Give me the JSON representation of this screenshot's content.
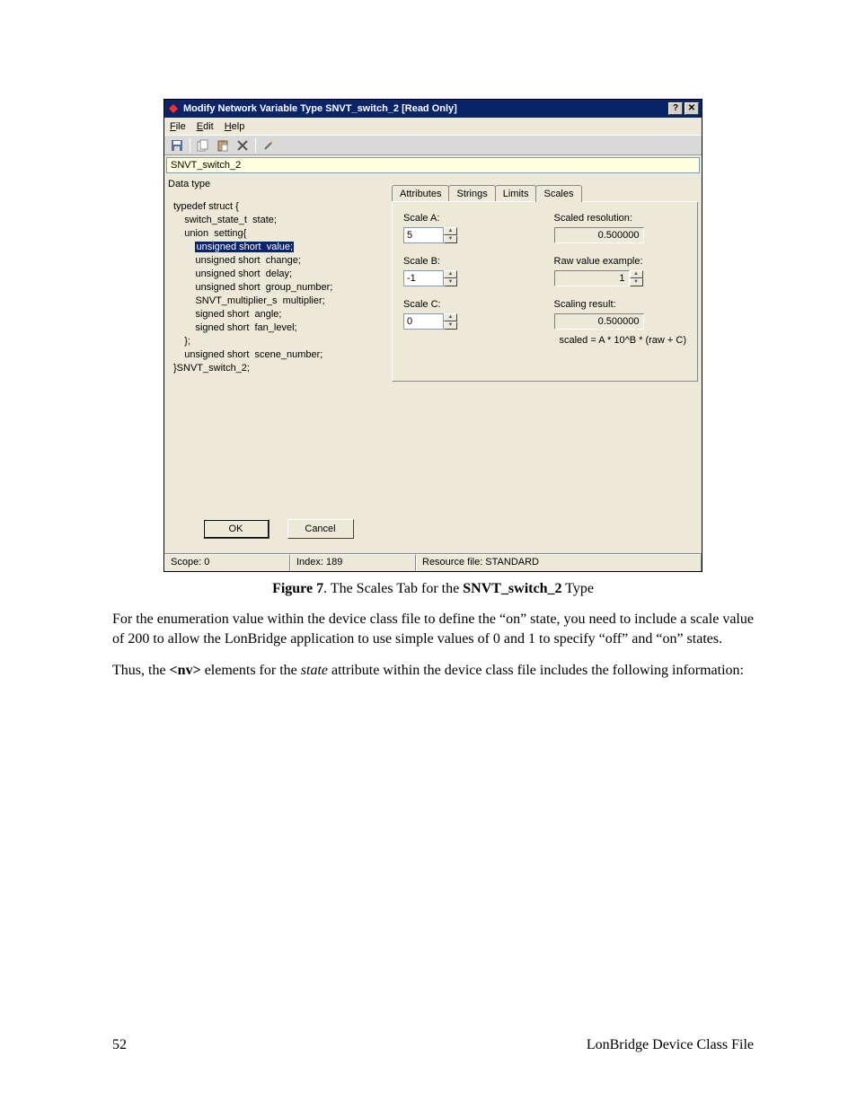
{
  "dialog": {
    "title": "Modify Network Variable Type SNVT_switch_2 [Read Only]",
    "help_btn": "?",
    "close_btn": "✕",
    "menus": {
      "file": "File",
      "file_u": "F",
      "edit": "Edit",
      "edit_u": "E",
      "help": "Help",
      "help_u": "H"
    },
    "var_name": "SNVT_switch_2",
    "data_type_label": "Data type",
    "code": {
      "l1": "typedef struct {",
      "l2": "    switch_state_t  state;",
      "l3": "    union  setting{",
      "l4_pre": "        ",
      "l4_hl": "unsigned short  value;",
      "l5": "        unsigned short  change;",
      "l6": "        unsigned short  delay;",
      "l7": "        unsigned short  group_number;",
      "l8": "        SNVT_multiplier_s  multiplier;",
      "l9": "        signed short  angle;",
      "l10": "        signed short  fan_level;",
      "l11": "    };",
      "l12": "    unsigned short  scene_number;",
      "l13": "}SNVT_switch_2;"
    },
    "ok": "OK",
    "cancel": "Cancel",
    "tabs": {
      "attr": "Attributes",
      "attr_u": "A",
      "str": "Strings",
      "lim": "Limits",
      "lim_u": "L",
      "sca": "Scales",
      "sca_u": "S"
    },
    "scales": {
      "a_label": "Scale A:",
      "a_val": "5",
      "b_label": "Scale B:",
      "b_val": "-1",
      "c_label": "Scale C:",
      "c_val": "0",
      "res_label": "Scaled resolution:",
      "res_val": "0.500000",
      "raw_label": "Raw value example:",
      "raw_val": "1",
      "out_label": "Scaling result:",
      "out_val": "0.500000",
      "formula": "scaled = A * 10^B * (raw + C)"
    },
    "status": {
      "scope": "Scope: 0",
      "index": "Index: 189",
      "res": "Resource file: STANDARD"
    }
  },
  "figure": {
    "caption_lead": "Figure 7",
    "caption_mid": ". The Scales Tab for the ",
    "caption_bold": "SNVT_switch_2",
    "caption_end": " Type"
  },
  "body": {
    "p1": "For the enumeration value within the device class file to define the “on” state, you need to include a scale value of 200 to allow the LonBridge application to use simple values of 0 and 1 to specify “off” and “on” states.",
    "p2_a": "Thus, the ",
    "p2_nv": "<nv>",
    "p2_b": " elements for the ",
    "p2_state": "state",
    "p2_c": " attribute within the device class file includes the following information:"
  },
  "footer": {
    "page": "52",
    "doc": "LonBridge Device Class File"
  }
}
